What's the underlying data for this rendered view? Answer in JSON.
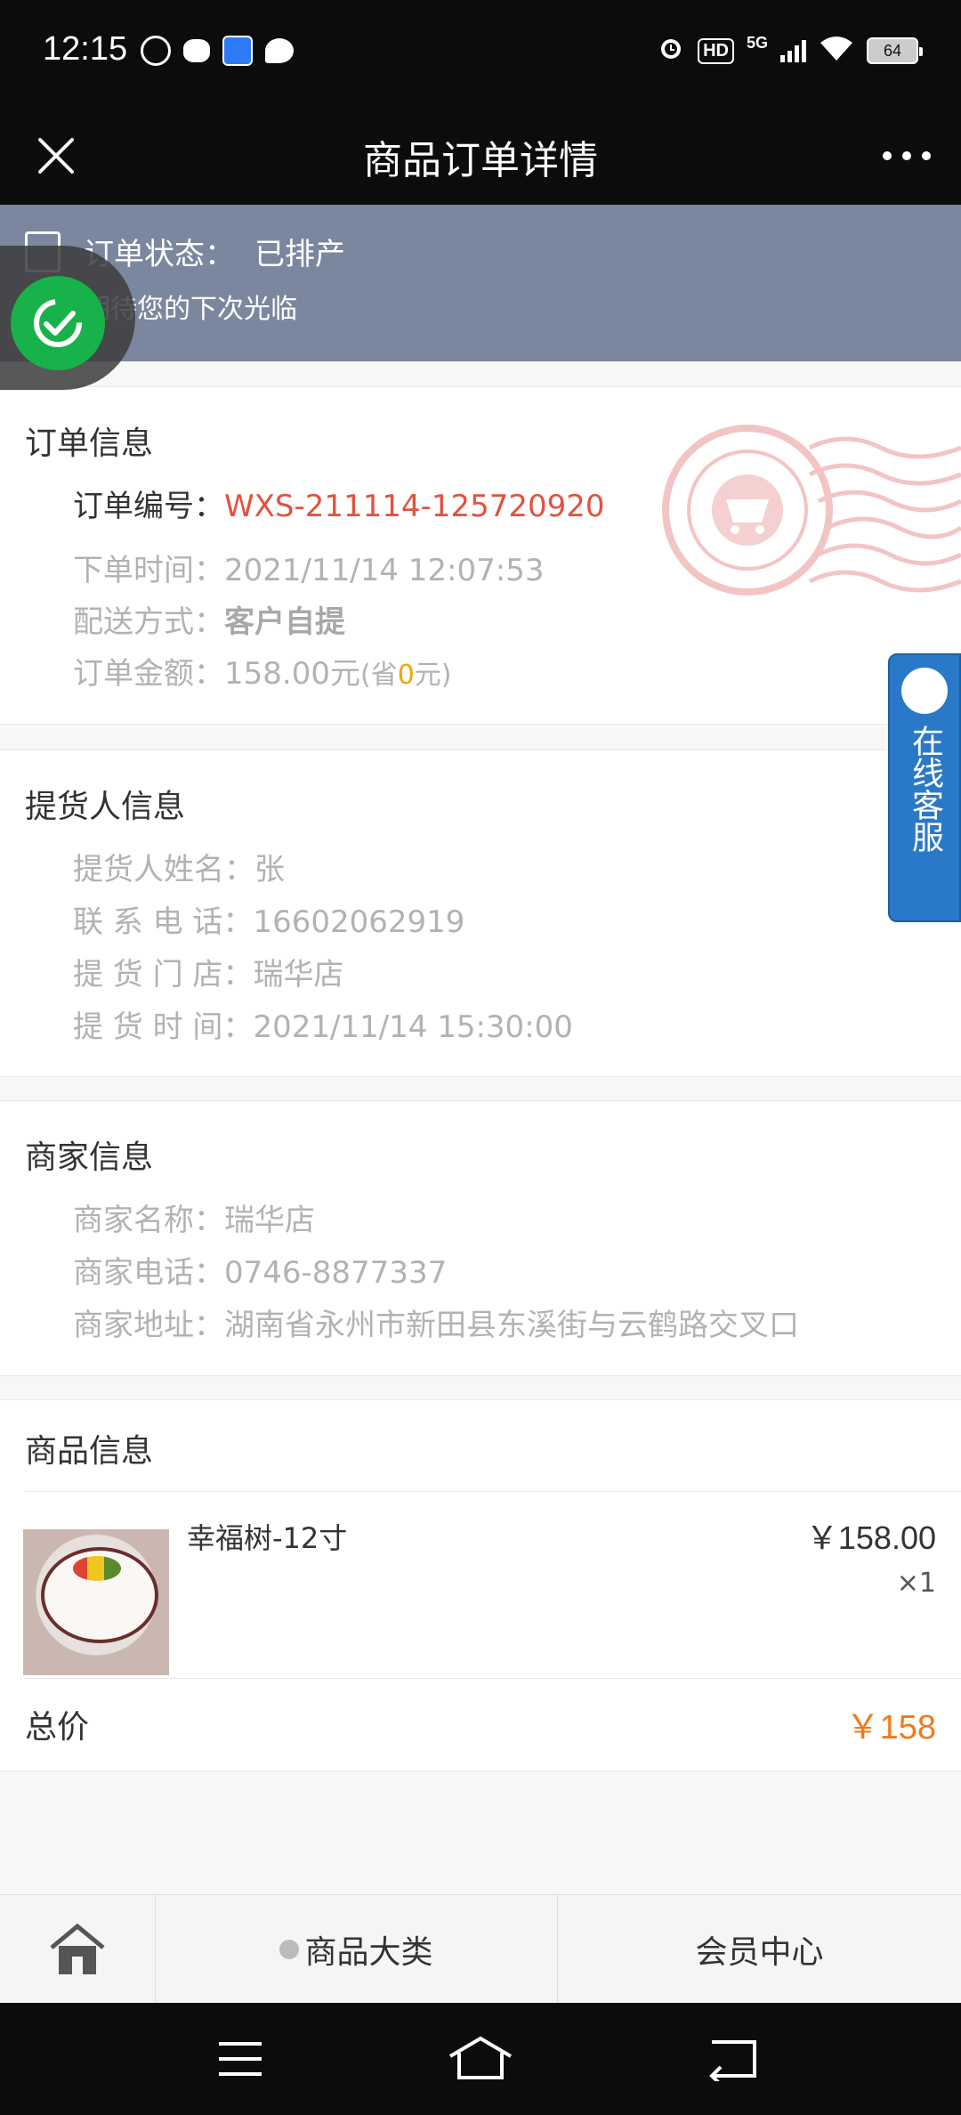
{
  "status_bar": {
    "time": "12:15",
    "battery": "64",
    "network": "5G",
    "hd": "HD"
  },
  "header": {
    "title": "商品订单详情"
  },
  "status_banner": {
    "label": "订单状态：",
    "value": "已排产",
    "subtitle": "期待您的下次光临"
  },
  "order_info": {
    "title": "订单信息",
    "number_label": "订单编号：",
    "number_value": "WXS-211114-125720920",
    "time_label": "下单时间：",
    "time_value": "2021/11/14 12:07:53",
    "delivery_label": "配送方式：",
    "delivery_value": "客户自提",
    "amount_label": "订单金额：",
    "amount_value": "158.00元",
    "saved_prefix": "(省",
    "saved_value": "0",
    "saved_suffix": "元)"
  },
  "pickup_info": {
    "title": "提货人信息",
    "name_label": "提货人姓名：",
    "name_value": "张",
    "phone_label": "联 系 电 话：",
    "phone_value": "16602062919",
    "store_label": "提 货 门 店：",
    "store_value": "瑞华店",
    "time_label": "提 货 时 间：",
    "time_value": "2021/11/14 15:30:00"
  },
  "merchant_info": {
    "title": "商家信息",
    "name_label": "商家名称：",
    "name_value": "瑞华店",
    "phone_label": "商家电话：",
    "phone_value": "0746-8877337",
    "address_label": "商家地址：",
    "address_value": "湖南省永州市新田县东溪街与云鹤路交叉口"
  },
  "product_info": {
    "title": "商品信息",
    "items": [
      {
        "name": "幸福树-12寸",
        "price": "￥158.00",
        "qty": "×1"
      }
    ],
    "total_label": "总价",
    "total_value": "￥158"
  },
  "service": {
    "label": "在线客服"
  },
  "bottom_nav": {
    "category": "商品大类",
    "member": "会员中心"
  },
  "colors": {
    "banner": "#7b879f",
    "red": "#e0533f",
    "orange": "#f07a1a",
    "service": "#2a79c8",
    "success": "#17b24a"
  }
}
